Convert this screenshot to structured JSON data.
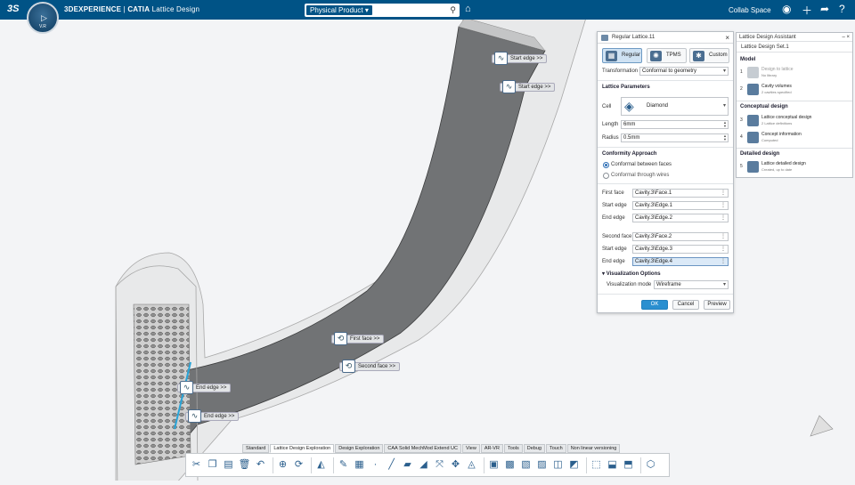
{
  "topbar": {
    "compass_version": "V.R",
    "brand_prefix": "3DEXPERIENCE",
    "brand_app": "CATIA",
    "brand_module": "Lattice Design",
    "search_scope": "Physical Product",
    "search_placeholder": "",
    "collab_space": "Collab Space"
  },
  "viewport": {
    "edge_tags": {
      "start_edge_1": "Start edge >>",
      "start_edge_2": "Start edge >>",
      "first_face": "First face >>",
      "second_face": "Second face >>",
      "end_edge_1": "End edge >>",
      "end_edge_2": "End edge >>"
    }
  },
  "dialog": {
    "title": "Regular Lattice.11",
    "types": [
      "Regular",
      "TPMS",
      "Custom"
    ],
    "transformation_label": "Transformation",
    "transformation_value": "Conformal to geometry",
    "lattice_params_heading": "Lattice Parameters",
    "cell_label": "Cell",
    "cell_value": "Diamond",
    "length_label": "Length",
    "length_value": "6mm",
    "radius_label": "Radius",
    "radius_value": "0.5mm",
    "conformity_heading": "Conformity Approach",
    "conformity_options": [
      "Conformal between faces",
      "Conformal through wires"
    ],
    "first_face_label": "First face",
    "first_face_value": "Cavity.3\\Face.1",
    "start_edge_label": "Start edge",
    "start_edge_value_1": "Cavity.3\\Edge.1",
    "end_edge_label": "End edge",
    "end_edge_value_1": "Cavity.3\\Edge.2",
    "second_face_label": "Second face",
    "second_face_value": "Cavity.3\\Face.2",
    "start_edge_value_2": "Cavity.3\\Edge.3",
    "end_edge_value_2": "Cavity.3\\Edge.4",
    "visualization_heading": "Visualization Options",
    "visualization_mode_label": "Visualization mode",
    "visualization_mode_value": "Wireframe",
    "ok": "OK",
    "cancel": "Cancel",
    "preview": "Preview"
  },
  "assistant": {
    "title": "Lattice Design Assistant",
    "set_name": "Lattice Design Set.1",
    "model_heading": "Model",
    "step1_title": "Design to lattice",
    "step1_sub": "No library",
    "step2_title": "Cavity volumes",
    "step2_sub": "2 cavities specified",
    "conceptual_heading": "Conceptual design",
    "step3_title": "Lattice conceptual design",
    "step3_sub": "2 Lattice definitions",
    "step4_title": "Concept information",
    "step4_sub": "Computed",
    "detailed_heading": "Detailed design",
    "step5_title": "Lattice detailed design",
    "step5_sub": "Created, up to date"
  },
  "tabs": [
    "Standard",
    "Lattice Design Exploration",
    "Design Exploration",
    "CAA Solid MechMod Extend UC",
    "View",
    "AR-VR",
    "Tools",
    "Debug",
    "Touch",
    "Non linear versioning"
  ],
  "active_tab": "Lattice Design Exploration"
}
